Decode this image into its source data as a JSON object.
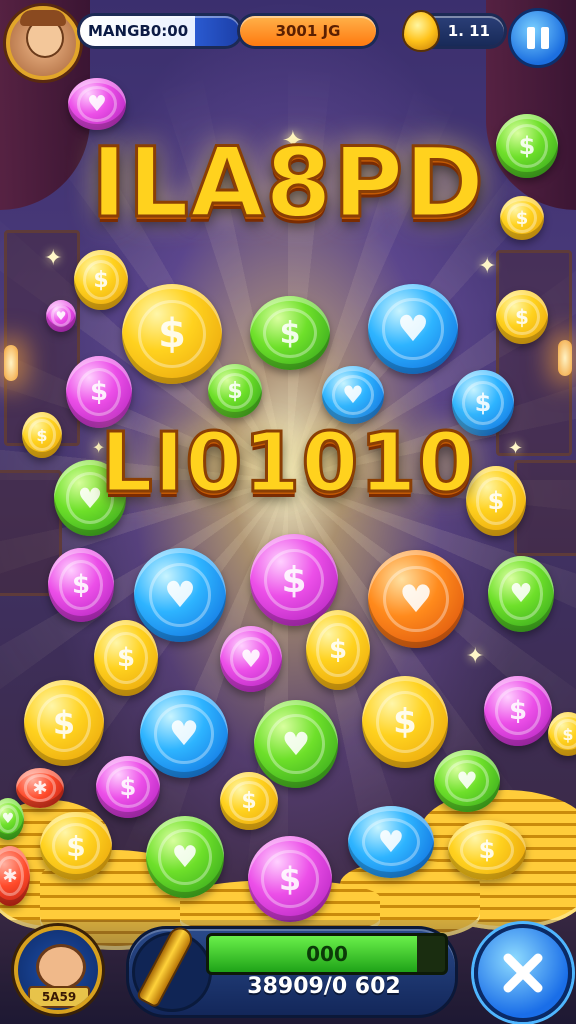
{
  "hud": {
    "player_name": "MANGB0:00",
    "progress_label": "3001 JG",
    "gem_count": "1. 11",
    "name_bar_fill": 0.72,
    "orange_bar_fill": 1.0
  },
  "title": {
    "line1": "ILA8PD",
    "line2": "LI01010"
  },
  "bottom": {
    "avatar_plate": "5A59",
    "progress_label": "000",
    "progress_fill": 0.88,
    "score": "38909/0 602",
    "close_symbol": "✕"
  },
  "icons": {
    "pause": "pause-icon",
    "close": "close-icon",
    "gem": "gem-icon",
    "bullet": "bullet-icon",
    "coin_symbol": "$"
  },
  "colors": {
    "title_gold": "#ffd21e",
    "progress_green": "#2fc21f",
    "hud_blue": "#1c6fe0",
    "hud_orange": "#ff8a1c"
  }
}
